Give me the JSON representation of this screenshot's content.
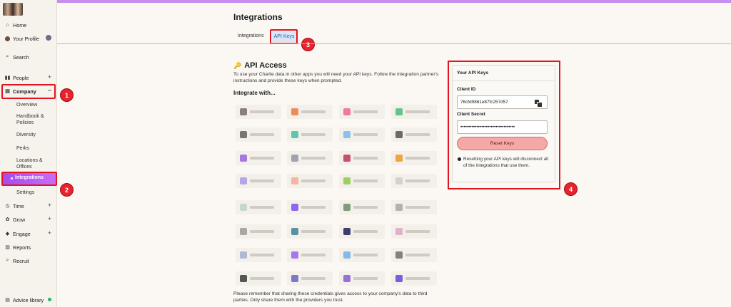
{
  "sidebar": {
    "items": [
      {
        "label": "Home",
        "icon": "home-icon"
      },
      {
        "label": "Your Profile",
        "icon": "profile-icon"
      },
      {
        "label": "Search",
        "icon": "search-icon"
      },
      {
        "label": "People",
        "icon": "people-icon"
      },
      {
        "label": "Company",
        "icon": "company-icon"
      },
      {
        "label": "Time",
        "icon": "time-icon"
      },
      {
        "label": "Grow",
        "icon": "grow-icon"
      },
      {
        "label": "Engage",
        "icon": "engage-icon"
      },
      {
        "label": "Reports",
        "icon": "reports-icon"
      },
      {
        "label": "Recruit",
        "icon": "recruit-icon"
      },
      {
        "label": "Advice library",
        "icon": "book-icon"
      }
    ],
    "company_sub": [
      "Overview",
      "Handbook & Policies",
      "Diversity",
      "Perks",
      "Locations & Offices",
      "Integrations",
      "Settings"
    ],
    "plus": "+",
    "minus": "−"
  },
  "page": {
    "title": "Integrations",
    "tabs": [
      "Integrations",
      "API Keys"
    ]
  },
  "api": {
    "title": "API Access",
    "description": "To use your Charlie data in other apps you will need your API keys. Follow the integration partner's instructions and provide these keys when prompted.",
    "integrate_heading": "Integrate with...",
    "bottom_note": "Please remember that sharing these credentials gives access to your company's data to third parties. Only share them with the providers you trust."
  },
  "keys_panel": {
    "title": "Your API Keys",
    "client_id_label": "Client ID",
    "client_id": "76cfd9861e87fc257d57",
    "client_secret_label": "Client Secret",
    "client_secret": "••••••••••••••••••••••••••••••••••",
    "reset_label": "Reset Keys",
    "warning": "Resetting your API keys will disconnect all of the integrations that use them."
  },
  "annotations": [
    "1",
    "2",
    "3",
    "4"
  ],
  "logo_colors": [
    [
      "#8a7f7a",
      "#f08a5b",
      "#f07a9e",
      "#63c48a"
    ],
    [
      "#7d7470",
      "#5ec4b4",
      "#8cc0f0",
      "#6a6a6a"
    ],
    [
      "#a777e0",
      "#9fa3b5",
      "#c9506a",
      "#f0a640"
    ],
    [
      "#b9a4e8",
      "#f4b4a6",
      "#9bd060",
      "#d6d1cb"
    ],
    [
      "#c7d7d0",
      "#8f66f0",
      "#7f9a7d",
      "#b6b0aa"
    ],
    [
      "#aaa6a2",
      "#5a8fa8",
      "#3d3d6b",
      "#e0b2c8"
    ],
    [
      "#b0b8d6",
      "#a678f0",
      "#86b8ea",
      "#8c7d7a"
    ],
    [
      "#555555",
      "#7a7ac8",
      "#9a70d8",
      "#7b5ce0"
    ]
  ]
}
